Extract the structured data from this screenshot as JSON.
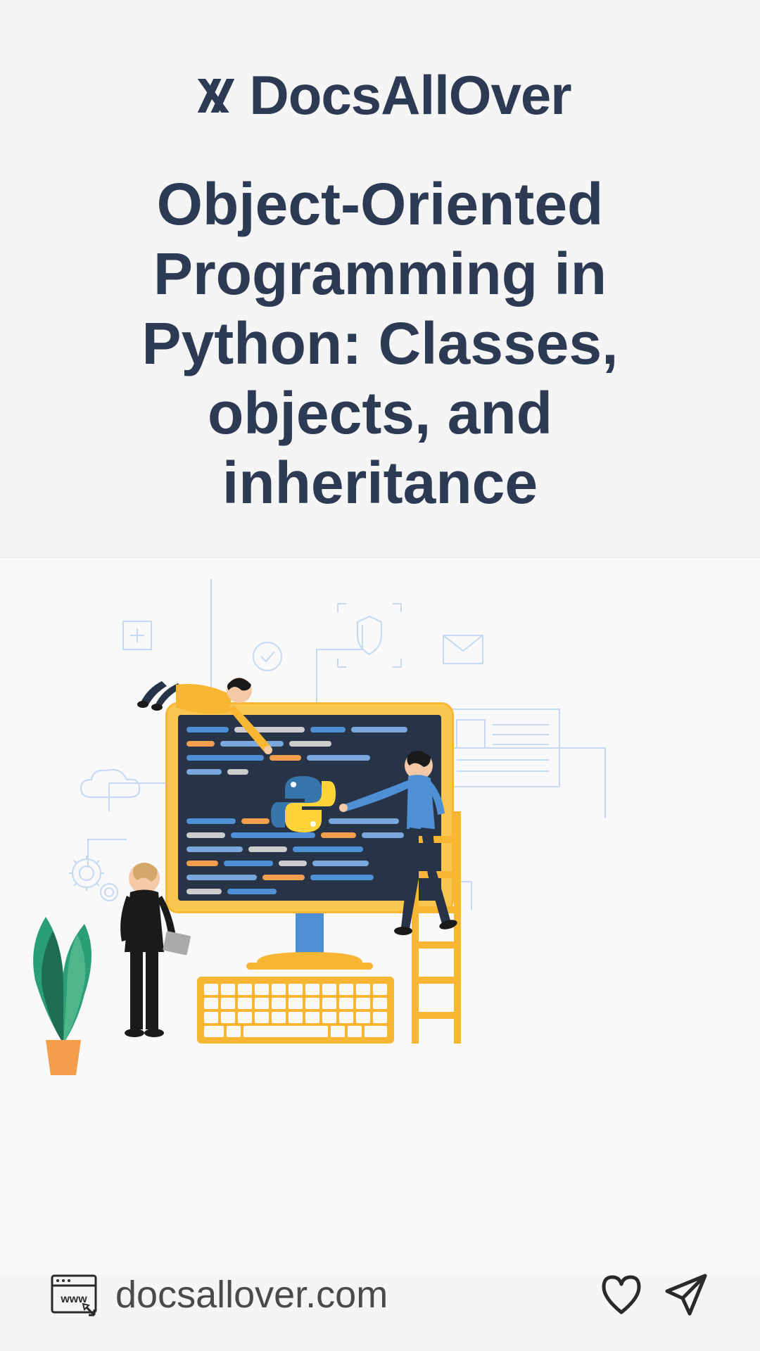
{
  "header": {
    "brand": "DocsAllOver",
    "title": "Object-Oriented Programming in Python: Classes, objects, and inheritance"
  },
  "footer": {
    "website": "docsallover.com"
  },
  "icons": {
    "logo": "stripe-x-icon",
    "www": "browser-www-icon",
    "heart": "heart-icon",
    "share": "paper-plane-icon"
  }
}
